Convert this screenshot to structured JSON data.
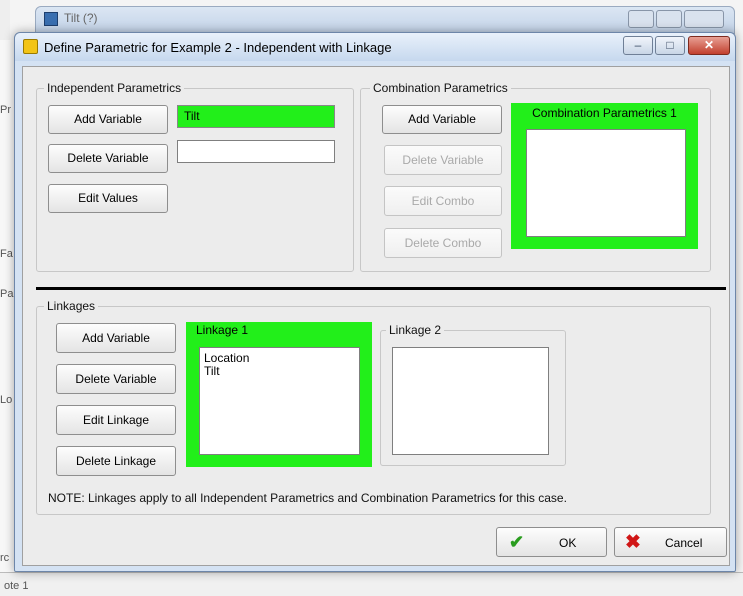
{
  "background": {
    "title": "Tilt (?)",
    "side_labels": [
      "Pr",
      "Fa",
      "Pa",
      "Lo",
      "rc",
      "ote 1"
    ]
  },
  "dialog": {
    "title": "Define Parametric for Example 2 - Independent with Linkage",
    "title_buttons": {
      "minimize": "–",
      "maximize": "□",
      "close": "✕"
    }
  },
  "independent": {
    "label": "Independent Parametrics",
    "add_variable": "Add Variable",
    "delete_variable": "Delete Variable",
    "edit_values": "Edit Values",
    "selected_variable": "Tilt",
    "empty_field": ""
  },
  "combination": {
    "label": "Combination Parametrics",
    "add_variable": "Add Variable",
    "delete_variable": "Delete Variable",
    "edit_combo": "Edit Combo",
    "delete_combo": "Delete Combo",
    "panel_title": "Combination Parametrics 1"
  },
  "linkages": {
    "label": "Linkages",
    "add_variable": "Add Variable",
    "delete_variable": "Delete Variable",
    "edit_linkage": "Edit Linkage",
    "delete_linkage": "Delete Linkage",
    "linkage1": {
      "title": "Linkage 1",
      "items": [
        "Location",
        "Tilt"
      ]
    },
    "linkage2": {
      "title": "Linkage 2",
      "items": []
    },
    "note": "NOTE: Linkages apply to all Independent Parametrics and Combination Parametrics for this case."
  },
  "footer": {
    "ok": "OK",
    "cancel": "Cancel"
  },
  "colors": {
    "highlight_green": "#22ef1a",
    "close_red": "#c2402e",
    "ok_check": "#2a9d1f",
    "cancel_x": "#d01616"
  }
}
